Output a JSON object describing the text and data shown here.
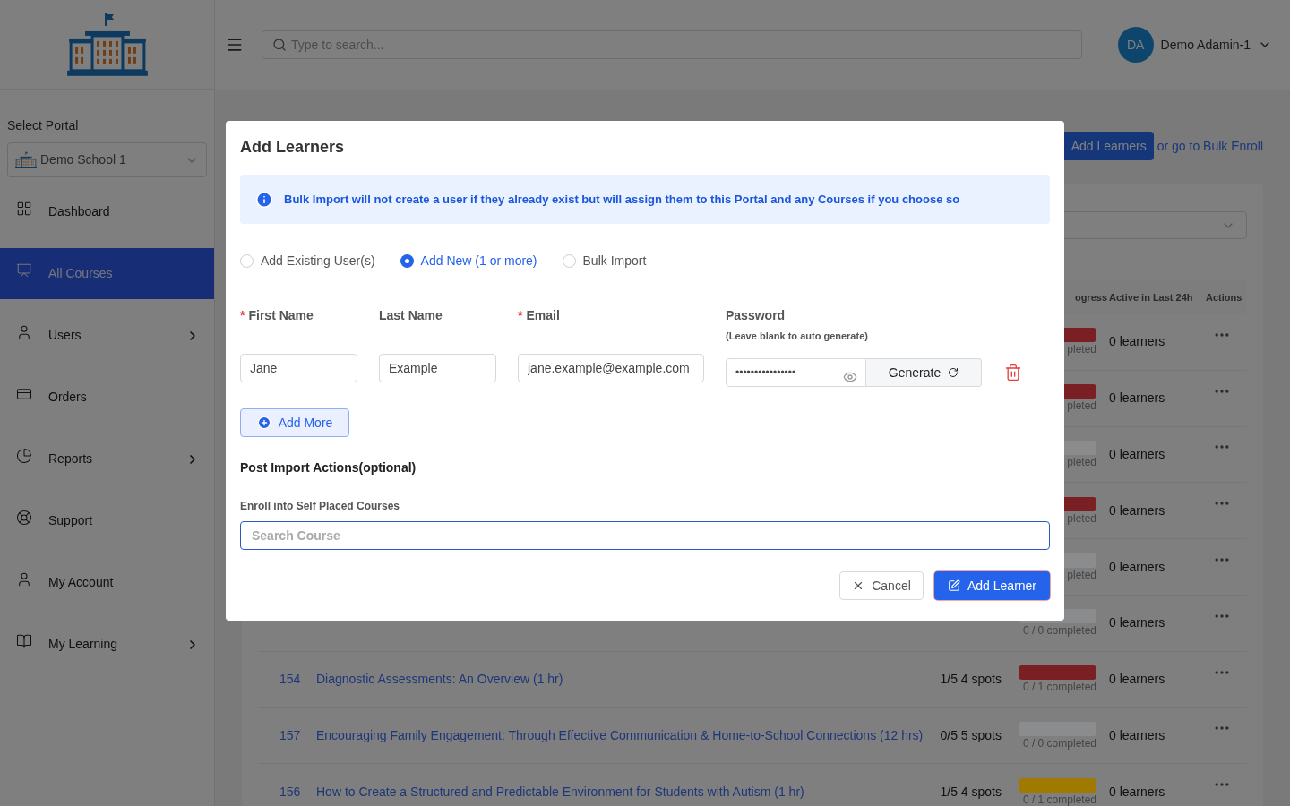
{
  "sidebar": {
    "portal_label": "Select Portal",
    "portal": "Demo School 1",
    "items": [
      {
        "label": "Dashboard",
        "selected": false,
        "submenu": false
      },
      {
        "label": "All Courses",
        "selected": true,
        "submenu": false
      },
      {
        "label": "Users",
        "selected": false,
        "submenu": true
      },
      {
        "label": "Orders",
        "selected": false,
        "submenu": false
      },
      {
        "label": "Reports",
        "selected": false,
        "submenu": true
      },
      {
        "label": "Support",
        "selected": false,
        "submenu": false
      },
      {
        "label": "My Account",
        "selected": false,
        "submenu": false
      },
      {
        "label": "My Learning",
        "selected": false,
        "submenu": true
      }
    ]
  },
  "header": {
    "search_placeholder": "Type to search...",
    "avatar": "DA",
    "user": "Demo Adamin-1"
  },
  "page": {
    "add_button": "Add Learners",
    "bulk_link": "or go to Bulk Enroll",
    "table": {
      "columns": [
        "ogress",
        "Active in Last 24h",
        "Actions"
      ],
      "rows": [
        {
          "progress": "pleted",
          "color": "#7a1f24",
          "active": "0 learners"
        },
        {
          "progress": "pleted",
          "color": "#7a1f24",
          "active": "0 learners"
        },
        {
          "progress": "pleted",
          "color": "#8a8c8e",
          "active": "0 learners"
        },
        {
          "progress": "pleted",
          "color": "#7a1f24",
          "active": "0 learners"
        },
        {
          "progress": "pleted",
          "color": "#8a8c8e",
          "active": "0 learners"
        },
        {
          "progress": "0 / 0 completed",
          "color": "#8a8c8e",
          "active": "0 learners"
        },
        {
          "id": "154",
          "title": "Diagnostic Assessments: An Overview (1 hr)",
          "spots": "1/5 4 spots",
          "progress": "0 / 1 completed",
          "color": "#7a1f24",
          "active": "0 learners"
        },
        {
          "id": "157",
          "title": "Encouraging Family Engagement: Through Effective Communication & Home-to-School Connections (12 hrs)",
          "spots": "0/5 5 spots",
          "progress": "0 / 0 completed",
          "color": "#8a8c8e",
          "active": "0 learners"
        },
        {
          "id": "156",
          "title": "How to Create a Structured and Predictable Environment for Students with Autism (1 hr)",
          "spots": "1/5 4 spots",
          "progress": "0 / 1 completed",
          "color": "#a07a00",
          "active": "0 learners"
        }
      ]
    }
  },
  "dialog": {
    "title": "Add Learners",
    "notice": "Bulk Import will not create a user if they already exist but will assign them to this Portal and any Courses if you choose so",
    "modes": [
      {
        "label": "Add Existing User(s)",
        "selected": false
      },
      {
        "label": "Add New (1 or more)",
        "selected": true
      },
      {
        "label": "Bulk Import",
        "selected": false
      }
    ],
    "required_marker": "*",
    "fields": [
      {
        "label": "First Name",
        "required": true,
        "value": "Jane"
      },
      {
        "label": "Last Name",
        "required": false,
        "value": "Example"
      },
      {
        "label": "Email",
        "required": true,
        "value": "jane.example@example.com"
      }
    ],
    "password": {
      "label": "Password",
      "hint": "(Leave blank to auto generate)",
      "value": "••••••••••••••••",
      "generate": "Generate"
    },
    "add_more": "Add More",
    "post_heading": "Post Import Actions(optional)",
    "enroll_label": "Enroll into Self Placed Courses",
    "course_placeholder": "Search Course",
    "cancel": "Cancel",
    "submit": "Add Learner"
  }
}
